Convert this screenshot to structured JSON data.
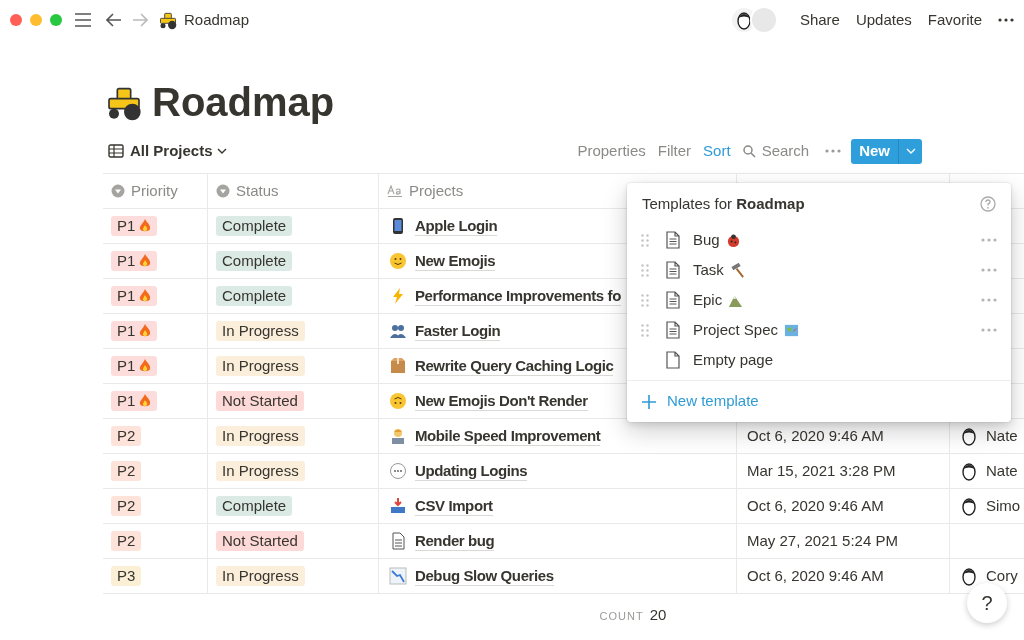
{
  "topbar": {
    "breadcrumb": "Roadmap",
    "actions": [
      "Share",
      "Updates",
      "Favorite"
    ]
  },
  "page": {
    "title": "Roadmap"
  },
  "view": {
    "name": "All Projects",
    "tools": [
      {
        "label": "Properties",
        "selected": false
      },
      {
        "label": "Filter",
        "selected": false
      },
      {
        "label": "Sort",
        "selected": true
      },
      {
        "label": "Search",
        "selected": false
      }
    ],
    "new_button": "New"
  },
  "table": {
    "columns": [
      "Priority",
      "Status",
      "Projects"
    ],
    "rows": [
      {
        "priority": {
          "label": "P1",
          "hot": true,
          "color": "#fddcdc"
        },
        "status": {
          "label": "Complete",
          "color": "#dbeae4"
        },
        "project": "Apple Login"
      },
      {
        "priority": {
          "label": "P1",
          "hot": true,
          "color": "#fddcdc"
        },
        "status": {
          "label": "Complete",
          "color": "#dbeae4"
        },
        "project": "New Emojis"
      },
      {
        "priority": {
          "label": "P1",
          "hot": true,
          "color": "#fddcdc"
        },
        "status": {
          "label": "Complete",
          "color": "#dbeae4"
        },
        "project": "Performance Improvements fo"
      },
      {
        "priority": {
          "label": "P1",
          "hot": true,
          "color": "#fddcdc"
        },
        "status": {
          "label": "In Progress",
          "color": "#fbeedb"
        },
        "project": "Faster Login"
      },
      {
        "priority": {
          "label": "P1",
          "hot": true,
          "color": "#fddcdc"
        },
        "status": {
          "label": "In Progress",
          "color": "#fbeedb"
        },
        "project": "Rewrite Query Caching Logic"
      },
      {
        "priority": {
          "label": "P1",
          "hot": true,
          "color": "#fddcdc"
        },
        "status": {
          "label": "Not Started",
          "color": "#fdd9d7"
        },
        "project": "New Emojis Don't Render"
      },
      {
        "priority": {
          "label": "P2",
          "hot": false,
          "color": "#fde3d9"
        },
        "status": {
          "label": "In Progress",
          "color": "#fbeedb"
        },
        "project": "Mobile Speed Improvement",
        "column_4": "Oct 6, 2020 9:46 AM",
        "column_5": "Nate"
      },
      {
        "priority": {
          "label": "P2",
          "hot": false,
          "color": "#fde3d9"
        },
        "status": {
          "label": "In Progress",
          "color": "#fbeedb"
        },
        "project": "Updating Logins",
        "column_4": "Mar 15, 2021 3:28 PM",
        "column_5": "Nate"
      },
      {
        "priority": {
          "label": "P2",
          "hot": false,
          "color": "#fde3d9"
        },
        "status": {
          "label": "Complete",
          "color": "#dbeae4"
        },
        "project": "CSV Import",
        "column_4": "Oct 6, 2020 9:46 AM",
        "column_5": "Simo"
      },
      {
        "priority": {
          "label": "P2",
          "hot": false,
          "color": "#fde3d9"
        },
        "status": {
          "label": "Not Started",
          "color": "#fdd9d7"
        },
        "project": "Render bug",
        "column_4": "May 27, 2021 5:24 PM"
      },
      {
        "priority": {
          "label": "P3",
          "hot": false,
          "color": "#fbf0d6"
        },
        "status": {
          "label": "In Progress",
          "color": "#fbeedb"
        },
        "project": "Debug Slow Queries",
        "column_4": "Oct 6, 2020 9:46 AM",
        "column_5": "Cory"
      }
    ],
    "count_label": "COUNT",
    "count": "20"
  },
  "templates_menu": {
    "title": "Templates for **Roadmap**",
    "items": [
      {
        "label": "Bug",
        "kind": "template"
      },
      {
        "label": "Task",
        "kind": "template"
      },
      {
        "label": "Epic",
        "kind": "template"
      },
      {
        "label": "Project Spec",
        "kind": "template"
      },
      {
        "label": "Empty page",
        "kind": "empty"
      }
    ],
    "new_template": "New template"
  },
  "help_button": "?"
}
